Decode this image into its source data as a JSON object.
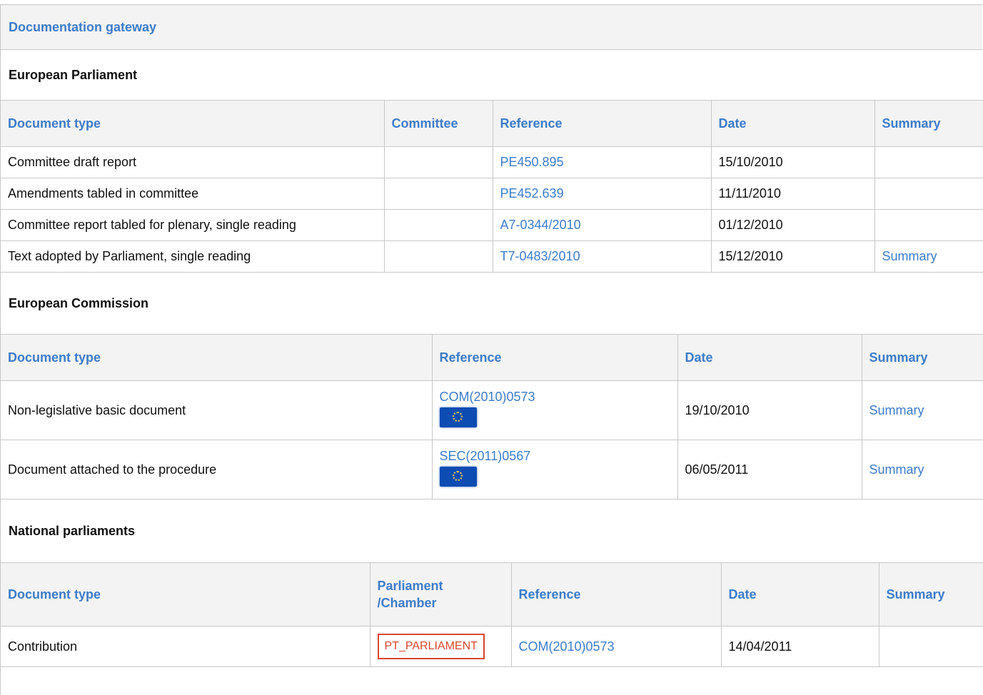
{
  "gateway": {
    "title": "Documentation gateway"
  },
  "ep": {
    "title": "European Parliament",
    "headers": [
      "Document type",
      "Committee",
      "Reference",
      "Date",
      "Summary"
    ],
    "rows": [
      {
        "type": "Committee draft report",
        "committee": "",
        "reference": "PE450.895",
        "date": "15/10/2010",
        "summary": ""
      },
      {
        "type": "Amendments tabled in committee",
        "committee": "",
        "reference": "PE452.639",
        "date": "11/11/2010",
        "summary": ""
      },
      {
        "type": "Committee report tabled for plenary, single reading",
        "committee": "",
        "reference": "A7-0344/2010",
        "date": "01/12/2010",
        "summary": ""
      },
      {
        "type": "Text adopted by Parliament, single reading",
        "committee": "",
        "reference": "T7-0483/2010",
        "date": "15/12/2010",
        "summary": "Summary"
      }
    ]
  },
  "ec": {
    "title": "European Commission",
    "headers": [
      "Document type",
      "Reference",
      "Date",
      "Summary"
    ],
    "rows": [
      {
        "type": "Non-legislative basic document",
        "reference": "COM(2010)0573",
        "icon": "eu-flag-icon",
        "date": "19/10/2010",
        "summary": "Summary"
      },
      {
        "type": "Document attached to the procedure",
        "reference": "SEC(2011)0567",
        "icon": "eu-flag-icon",
        "date": "06/05/2011",
        "summary": "Summary"
      }
    ]
  },
  "np": {
    "title": "National parliaments",
    "headers": [
      "Document type",
      "Parliament\n/Chamber",
      "Reference",
      "Date",
      "Summary"
    ],
    "rows": [
      {
        "type": "Contribution",
        "chamber": "PT_PARLIAMENT",
        "reference": "COM(2010)0573",
        "date": "14/04/2011",
        "summary": ""
      }
    ]
  },
  "colors": {
    "link": "#3d7cc9",
    "badge": "#d9462f",
    "flag": "#0c4cb3"
  }
}
